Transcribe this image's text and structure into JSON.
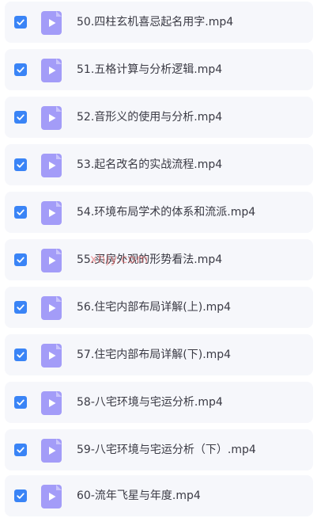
{
  "colors": {
    "row_background": "#f6f7fb",
    "checkbox_checked": "#3a84f6",
    "video_icon": "#a39cf8",
    "text": "#3a3a44",
    "watermark": "#ea5454"
  },
  "files": [
    {
      "name": "50.四柱玄机喜忌起名用字.mp4",
      "checked": true,
      "icon": "video-file-icon"
    },
    {
      "name": "51.五格计算与分析逻辑.mp4",
      "checked": true,
      "icon": "video-file-icon"
    },
    {
      "name": "52.音形义的使用与分析.mp4",
      "checked": true,
      "icon": "video-file-icon"
    },
    {
      "name": "53.起名改名的实战流程.mp4",
      "checked": true,
      "icon": "video-file-icon"
    },
    {
      "name": "54.环境布局学术的体系和流派.mp4",
      "checked": true,
      "icon": "video-file-icon"
    },
    {
      "name": "55.买房外观的形势看法.mp4",
      "checked": true,
      "icon": "video-file-icon"
    },
    {
      "name": "56.住宅内部布局详解(上).mp4",
      "checked": true,
      "icon": "video-file-icon"
    },
    {
      "name": "57.住宅内部布局详解(下).mp4",
      "checked": true,
      "icon": "video-file-icon"
    },
    {
      "name": "58-八宅环境与宅运分析.mp4",
      "checked": true,
      "icon": "video-file-icon"
    },
    {
      "name": "59-八宅环境与宅运分析（下）.mp4",
      "checked": true,
      "icon": "video-file-icon"
    },
    {
      "name": "60-流年飞星与年度.mp4",
      "checked": true,
      "icon": "video-file-icon"
    }
  ],
  "watermark": {
    "text": "xhjy.com"
  }
}
